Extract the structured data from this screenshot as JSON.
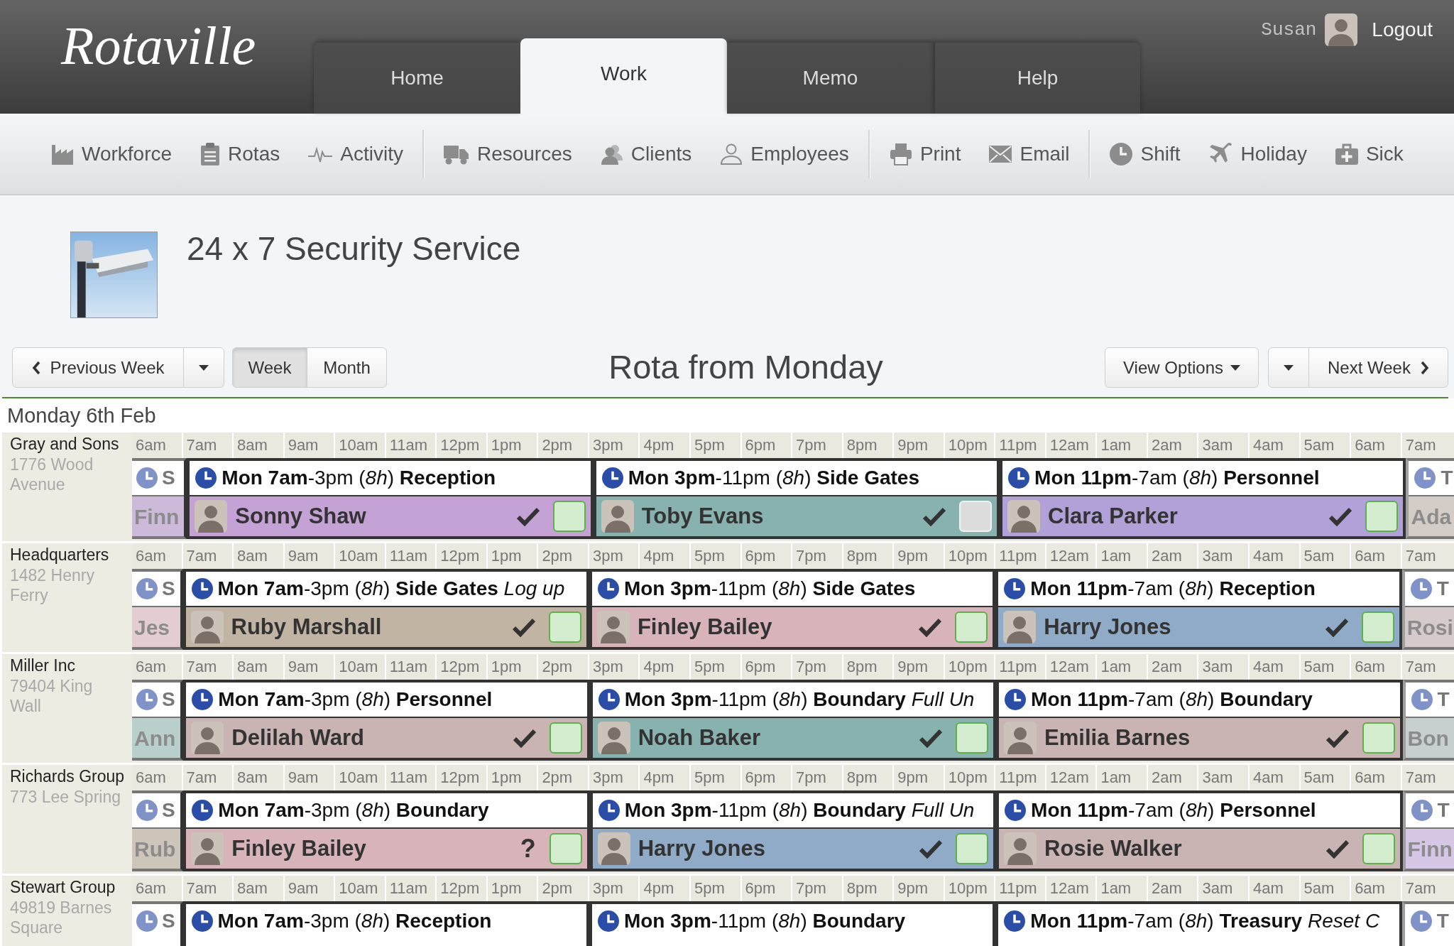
{
  "header": {
    "logo": "Rotaville",
    "tabs": [
      {
        "label": "Home",
        "selected": false
      },
      {
        "label": "Work",
        "selected": true
      },
      {
        "label": "Memo",
        "selected": false
      },
      {
        "label": "Help",
        "selected": false
      }
    ],
    "user": {
      "name": "Susan",
      "logout": "Logout"
    }
  },
  "toolbar": {
    "groups": [
      [
        "Workforce",
        "Rotas",
        "Activity"
      ],
      [
        "Resources",
        "Clients",
        "Employees"
      ],
      [
        "Print",
        "Email"
      ],
      [
        "Shift",
        "Holiday",
        "Sick"
      ]
    ]
  },
  "service": {
    "title": "24 x 7 Security Service"
  },
  "controls": {
    "previous": "Previous Week",
    "views": [
      {
        "label": "Week",
        "selected": true
      },
      {
        "label": "Month",
        "selected": false
      }
    ],
    "heading": "Rota from Monday",
    "view_options": "View Options",
    "next": "Next Week"
  },
  "day": {
    "label": "Monday 6th Feb"
  },
  "clients": [
    {
      "name": "Gray and Sons",
      "address": "1776 Wood Avenue",
      "hours": [
        "6am",
        "7am",
        "8am",
        "9am",
        "10am",
        "11am",
        "12pm",
        "1pm",
        "2pm",
        "3pm",
        "4pm",
        "5pm",
        "6pm",
        "7pm",
        "8pm",
        "9pm",
        "10pm",
        "11pm",
        "12am",
        "1am",
        "2am",
        "3am",
        "4am",
        "5am",
        "6am",
        "7am"
      ],
      "shifts": [
        {
          "kind": "clipped-start",
          "heading": "S",
          "employee": {
            "name": "Finn",
            "color": "#cdb9da"
          }
        },
        {
          "kind": "full",
          "heading": "**Mon 7am**-3pm (*8h*) **Reception**",
          "employee": {
            "name": "Sonny Shaw",
            "color": "#c4a2d5",
            "confirmed": true,
            "checked": true
          }
        },
        {
          "kind": "full",
          "heading": "**Mon 3pm**-11pm (*8h*) **Side Gates**",
          "employee": {
            "name": "Toby Evans",
            "color": "#88b2b0",
            "confirmed": true,
            "checked": false
          }
        },
        {
          "kind": "full",
          "heading": "**Mon 11pm**-7am (*8h*) **Personnel**",
          "employee": {
            "name": "Clara Parker",
            "color": "#b2a1d8",
            "confirmed": true,
            "checked": true
          }
        },
        {
          "kind": "clipped-end",
          "heading": "T",
          "employee": {
            "name": "Ada",
            "color": "#d4ccc6"
          }
        }
      ]
    },
    {
      "name": "Headquarters",
      "address": "1482 Henry Ferry",
      "hours": [
        "6am",
        "7am",
        "8am",
        "9am",
        "10am",
        "11am",
        "12pm",
        "1pm",
        "2pm",
        "3pm",
        "4pm",
        "5pm",
        "6pm",
        "7pm",
        "8pm",
        "9pm",
        "10pm",
        "11pm",
        "12am",
        "1am",
        "2am",
        "3am",
        "4am",
        "5am",
        "6am",
        "7am"
      ],
      "shifts": [
        {
          "kind": "clipped-start",
          "heading": "S",
          "employee": {
            "name": "Jes",
            "color": "#e3cdd0"
          }
        },
        {
          "kind": "full",
          "heading": "**Mon 7am**-3pm (*8h*) **Side Gates** *Log up*",
          "employee": {
            "name": "Ruby Marshall",
            "color": "#c1b4a3",
            "confirmed": true,
            "checked": true
          }
        },
        {
          "kind": "full",
          "heading": "**Mon 3pm**-11pm (*8h*) **Side Gates**",
          "employee": {
            "name": "Finley Bailey",
            "color": "#d8b3b9",
            "confirmed": true,
            "checked": true
          }
        },
        {
          "kind": "full",
          "heading": "**Mon 11pm**-7am (*8h*) **Reception**",
          "employee": {
            "name": "Harry Jones",
            "color": "#8fabc7",
            "confirmed": true,
            "checked": true
          }
        },
        {
          "kind": "clipped-end",
          "heading": "T",
          "employee": {
            "name": "Rosi",
            "color": "#d6cbca"
          }
        }
      ]
    },
    {
      "name": "Miller Inc",
      "address": "79404 King Wall",
      "hours": [
        "6am",
        "7am",
        "8am",
        "9am",
        "10am",
        "11am",
        "12pm",
        "1pm",
        "2pm",
        "3pm",
        "4pm",
        "5pm",
        "6pm",
        "7pm",
        "8pm",
        "9pm",
        "10pm",
        "11pm",
        "12am",
        "1am",
        "2am",
        "3am",
        "4am",
        "5am",
        "6am",
        "7am"
      ],
      "shifts": [
        {
          "kind": "clipped-start",
          "heading": "S",
          "employee": {
            "name": "Ann",
            "color": "#b8cfcc"
          }
        },
        {
          "kind": "full",
          "heading": "**Mon 7am**-3pm (*8h*) **Personnel**",
          "employee": {
            "name": "Delilah Ward",
            "color": "#c9b3b3",
            "confirmed": true,
            "checked": true
          }
        },
        {
          "kind": "full",
          "heading": "**Mon 3pm**-11pm (*8h*) **Boundary** *Full Un*",
          "employee": {
            "name": "Noah Baker",
            "color": "#88b2b0",
            "confirmed": true,
            "checked": true
          }
        },
        {
          "kind": "full",
          "heading": "**Mon 11pm**-7am (*8h*) **Boundary**",
          "employee": {
            "name": "Emilia Barnes",
            "color": "#c9b3b3",
            "confirmed": true,
            "checked": true
          }
        },
        {
          "kind": "clipped-end",
          "heading": "T",
          "employee": {
            "name": "Bon",
            "color": "#c8d0cf"
          }
        }
      ]
    },
    {
      "name": "Richards Group",
      "address": "773 Lee Spring",
      "hours": [
        "6am",
        "7am",
        "8am",
        "9am",
        "10am",
        "11am",
        "12pm",
        "1pm",
        "2pm",
        "3pm",
        "4pm",
        "5pm",
        "6pm",
        "7pm",
        "8pm",
        "9pm",
        "10pm",
        "11pm",
        "12am",
        "1am",
        "2am",
        "3am",
        "4am",
        "5am",
        "6am",
        "7am"
      ],
      "shifts": [
        {
          "kind": "clipped-start",
          "heading": "S",
          "employee": {
            "name": "Rub",
            "color": "#cdc5ba"
          }
        },
        {
          "kind": "full",
          "heading": "**Mon 7am**-3pm (*8h*) **Boundary**",
          "employee": {
            "name": "Finley Bailey",
            "color": "#d8b3b9",
            "confirmed": false,
            "query": "?",
            "checked": true
          }
        },
        {
          "kind": "full",
          "heading": "**Mon 3pm**-11pm (*8h*) **Boundary** *Full Un*",
          "employee": {
            "name": "Harry Jones",
            "color": "#8fabc7",
            "confirmed": true,
            "checked": true
          }
        },
        {
          "kind": "full",
          "heading": "**Mon 11pm**-7am (*8h*) **Personnel**",
          "employee": {
            "name": "Rosie Walker",
            "color": "#c9b3b3",
            "confirmed": true,
            "checked": true
          }
        },
        {
          "kind": "clipped-end",
          "heading": "T",
          "employee": {
            "name": "Finn",
            "color": "#d7c7e6"
          }
        }
      ]
    },
    {
      "name": "Stewart Group",
      "address": "49819 Barnes Square",
      "hours": [
        "6am",
        "7am",
        "8am",
        "9am",
        "10am",
        "11am",
        "12pm",
        "1pm",
        "2pm",
        "3pm",
        "4pm",
        "5pm",
        "6pm",
        "7pm",
        "8pm",
        "9pm",
        "10pm",
        "11pm",
        "12am",
        "1am",
        "2am",
        "3am",
        "4am",
        "5am",
        "6am",
        "7am"
      ],
      "shifts": [
        {
          "kind": "clipped-start",
          "heading": "S"
        },
        {
          "kind": "full",
          "heading": "**Mon 7am**-3pm (*8h*) **Reception**"
        },
        {
          "kind": "full",
          "heading": "**Mon 3pm**-11pm (*8h*) **Boundary**"
        },
        {
          "kind": "full",
          "heading": "**Mon 11pm**-7am (*8h*) **Treasury** *Reset C*"
        },
        {
          "kind": "clipped-end",
          "heading": "T"
        }
      ]
    }
  ]
}
